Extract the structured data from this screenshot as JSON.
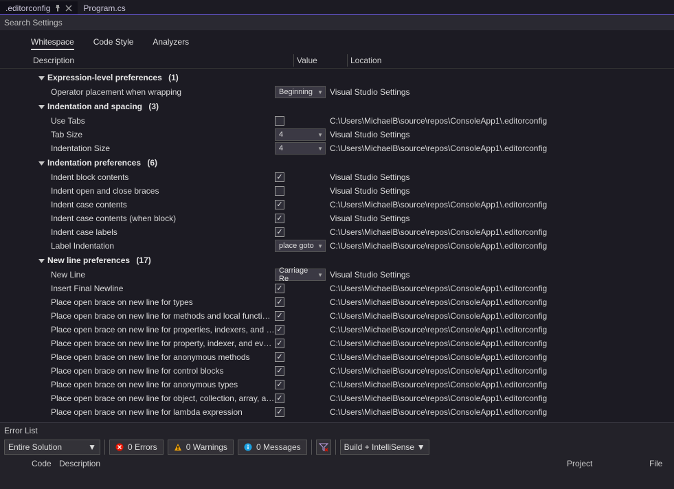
{
  "tabs": {
    "active": ".editorconfig",
    "inactive": "Program.cs"
  },
  "search": {
    "placeholder": "Search Settings"
  },
  "subtabs": [
    "Whitespace",
    "Code Style",
    "Analyzers"
  ],
  "columns": {
    "desc": "Description",
    "val": "Value",
    "loc": "Location"
  },
  "loc_vss": "Visual Studio Settings",
  "loc_file": "C:\\Users\\MichaelB\\source\\repos\\ConsoleApp1\\.editorconfig",
  "groups": [
    {
      "title": "Expression-level preferences",
      "count": "(1)",
      "rows": [
        {
          "desc": "Operator placement when wrapping",
          "type": "dd",
          "value": "Beginning",
          "loc": "vss"
        }
      ]
    },
    {
      "title": "Indentation and spacing",
      "count": "(3)",
      "rows": [
        {
          "desc": "Use Tabs",
          "type": "chk",
          "checked": false,
          "loc": "file"
        },
        {
          "desc": "Tab Size",
          "type": "dd",
          "value": "4",
          "loc": "vss"
        },
        {
          "desc": "Indentation Size",
          "type": "dd",
          "value": "4",
          "loc": "file"
        }
      ]
    },
    {
      "title": "Indentation preferences",
      "count": "(6)",
      "rows": [
        {
          "desc": "Indent block contents",
          "type": "chk",
          "checked": true,
          "loc": "vss"
        },
        {
          "desc": "Indent open and close braces",
          "type": "chk",
          "checked": false,
          "loc": "vss"
        },
        {
          "desc": "Indent case contents",
          "type": "chk",
          "checked": true,
          "loc": "file"
        },
        {
          "desc": "Indent case contents (when block)",
          "type": "chk",
          "checked": true,
          "loc": "vss"
        },
        {
          "desc": "Indent case labels",
          "type": "chk",
          "checked": true,
          "loc": "file"
        },
        {
          "desc": "Label Indentation",
          "type": "dd",
          "value": "place goto",
          "loc": "file"
        }
      ]
    },
    {
      "title": "New line preferences",
      "count": "(17)",
      "rows": [
        {
          "desc": "New Line",
          "type": "dd",
          "value": "Carriage Re",
          "loc": "vss"
        },
        {
          "desc": "Insert Final Newline",
          "type": "chk",
          "checked": true,
          "loc": "file"
        },
        {
          "desc": "Place open brace on new line for types",
          "type": "chk",
          "checked": true,
          "loc": "file"
        },
        {
          "desc": "Place open brace on new line for methods and local functions",
          "type": "chk",
          "checked": true,
          "loc": "file"
        },
        {
          "desc": "Place open brace on new line for properties, indexers, and events",
          "type": "chk",
          "checked": true,
          "loc": "file"
        },
        {
          "desc": "Place open brace on new line for property, indexer, and event ac...",
          "type": "chk",
          "checked": true,
          "loc": "file"
        },
        {
          "desc": "Place open brace on new line for anonymous methods",
          "type": "chk",
          "checked": true,
          "loc": "file"
        },
        {
          "desc": "Place open brace on new line for control blocks",
          "type": "chk",
          "checked": true,
          "loc": "file"
        },
        {
          "desc": "Place open brace on new line for anonymous types",
          "type": "chk",
          "checked": true,
          "loc": "file"
        },
        {
          "desc": "Place open brace on new line for object, collection, array, and wi...",
          "type": "chk",
          "checked": true,
          "loc": "file"
        },
        {
          "desc": "Place open brace on new line for lambda expression",
          "type": "chk",
          "checked": true,
          "loc": "file"
        }
      ]
    }
  ],
  "errorlist": {
    "title": "Error List",
    "scope": "Entire Solution",
    "errors": "0 Errors",
    "warnings": "0 Warnings",
    "messages": "0 Messages",
    "filter": "Build + IntelliSense",
    "cols": {
      "code": "Code",
      "desc": "Description",
      "project": "Project",
      "file": "File"
    }
  }
}
